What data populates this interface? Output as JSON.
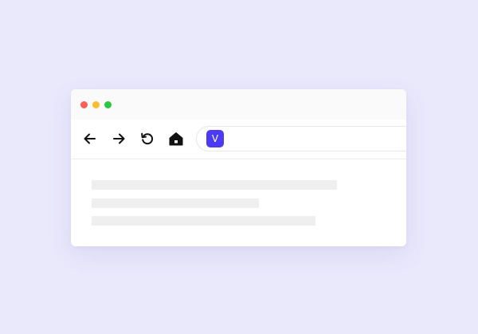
{
  "window": {
    "traffic_lights": {
      "close": {
        "icon": "close-dot",
        "color": "#FF5F57"
      },
      "minimize": {
        "icon": "minimize-dot",
        "color": "#FEBC2E"
      },
      "maximize": {
        "icon": "maximize-dot",
        "color": "#28C840"
      }
    }
  },
  "toolbar": {
    "back": {
      "icon": "arrow-left-icon"
    },
    "forward": {
      "icon": "arrow-right-icon"
    },
    "reload": {
      "icon": "reload-icon"
    },
    "home": {
      "icon": "home-icon"
    }
  },
  "address_bar": {
    "site_icon_letter": "V",
    "site_icon_color": "#4B3BF5",
    "url": ""
  },
  "content": {
    "placeholder_lines": 3,
    "placeholder_color": "#EFEFEF"
  },
  "colors": {
    "page_background": "#EAE8FB",
    "titlebar_background": "#FAFAFA"
  }
}
